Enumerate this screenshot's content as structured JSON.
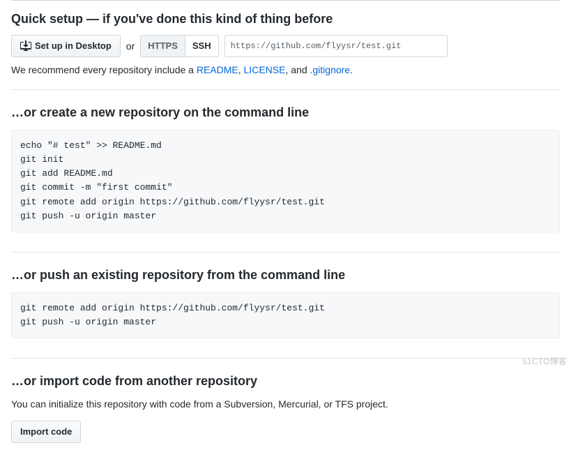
{
  "quickSetup": {
    "title": "Quick setup — if you've done this kind of thing before",
    "desktopButton": "Set up in Desktop",
    "orText": "or",
    "httpsLabel": "HTTPS",
    "sshLabel": "SSH",
    "repoUrl": "https://github.com/flyysr/test.git",
    "recommendPrefix": "We recommend every repository include a ",
    "readmeLink": "README",
    "comma1": ", ",
    "licenseLink": "LICENSE",
    "comma2": ", and ",
    "gitignoreLink": ".gitignore",
    "period": "."
  },
  "createRepo": {
    "title": "…or create a new repository on the command line",
    "code": "echo \"# test\" >> README.md\ngit init\ngit add README.md\ngit commit -m \"first commit\"\ngit remote add origin https://github.com/flyysr/test.git\ngit push -u origin master"
  },
  "pushRepo": {
    "title": "…or push an existing repository from the command line",
    "code": "git remote add origin https://github.com/flyysr/test.git\ngit push -u origin master"
  },
  "importRepo": {
    "title": "…or import code from another repository",
    "description": "You can initialize this repository with code from a Subversion, Mercurial, or TFS project.",
    "button": "Import code"
  },
  "watermark": "51CTO博客"
}
